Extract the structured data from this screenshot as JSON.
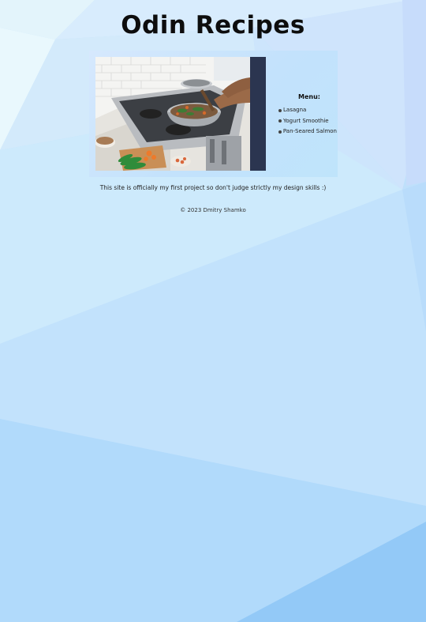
{
  "header": {
    "title": "Odin Recipes"
  },
  "hero_image": {
    "subject": "person cooking in a pan on a gas stove in a white tiled kitchen"
  },
  "menu": {
    "title": "Menu:",
    "items": [
      {
        "label": "Lasagna"
      },
      {
        "label": "Yogurt Smoothie"
      },
      {
        "label": "Pan-Seared Salmon"
      }
    ]
  },
  "note": "This site is officially my first project so don't judge strictly my design skills :)",
  "footer": {
    "copyright": "© 2023 Dmitry Shamko"
  },
  "colors": {
    "background_base": "#bfe0fb",
    "card_background": "#c9e4fc",
    "text": "#111111"
  }
}
